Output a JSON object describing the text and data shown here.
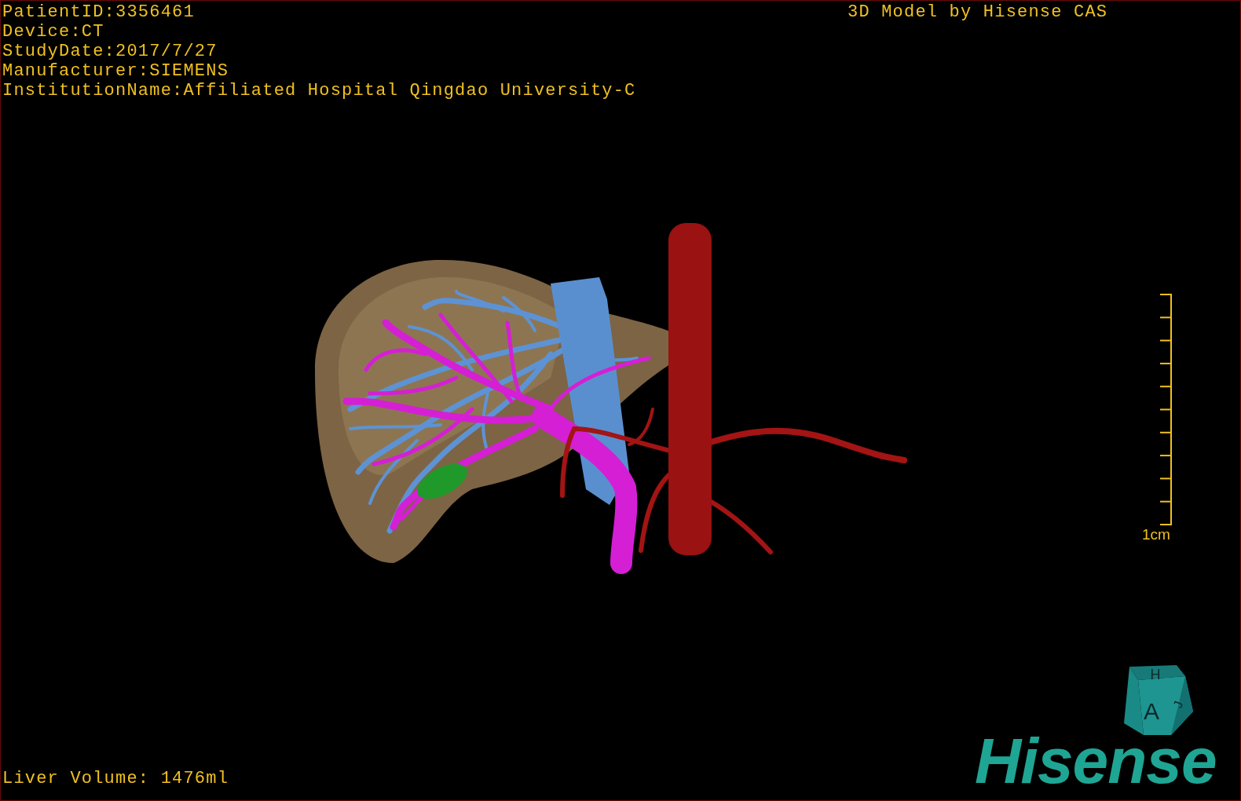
{
  "patient_info": [
    "PatientID:3356461",
    "Device:CT",
    "StudyDate:2017/7/27",
    "Manufacturer:SIEMENS",
    "InstitutionName:Affiliated Hospital Qingdao University-C"
  ],
  "title": "3D Model by Hisense CAS",
  "scale_bar": {
    "label": "1cm"
  },
  "orientation_cube": {
    "top": "H",
    "front": "A",
    "side": "J"
  },
  "logo": {
    "text": "Hisense"
  },
  "liver_volume": "Liver Volume: 1476ml"
}
